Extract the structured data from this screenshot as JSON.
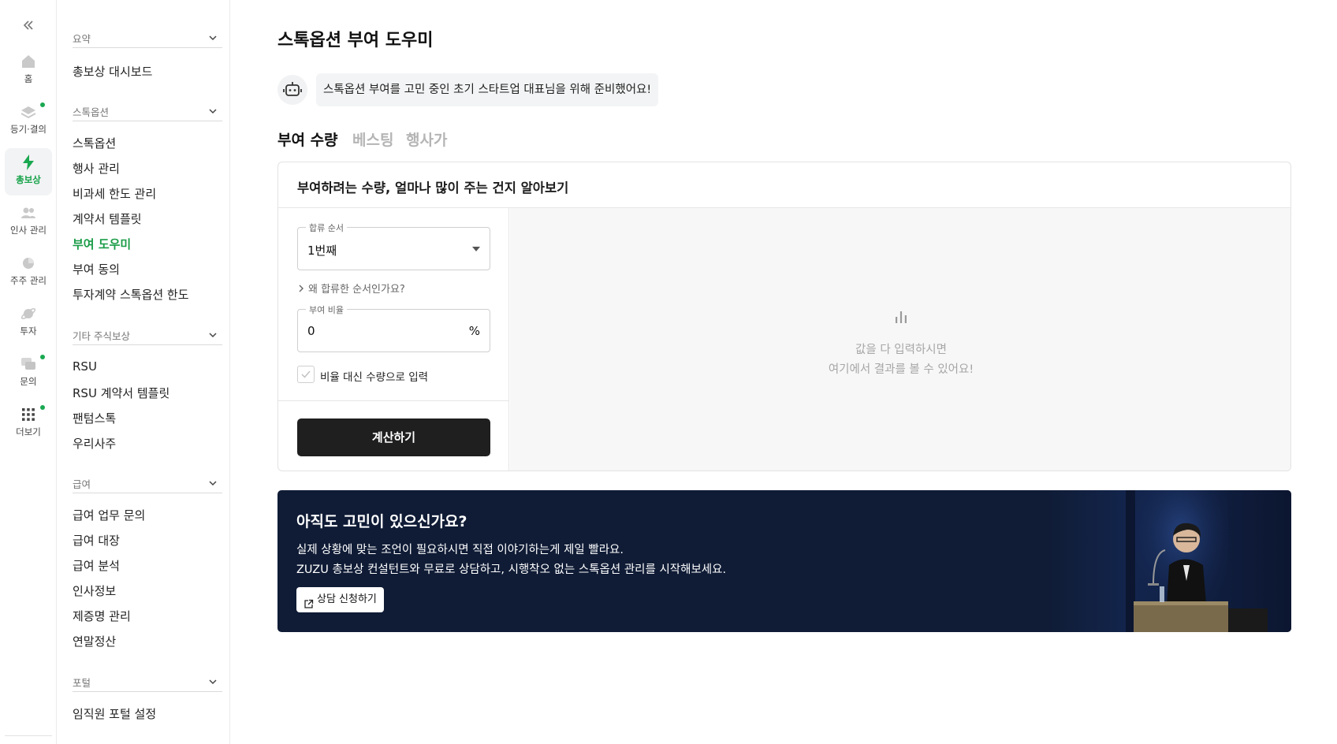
{
  "rail": {
    "items": [
      {
        "label": "홈",
        "icon": "home-icon"
      },
      {
        "label": "등기·결의",
        "icon": "layers-icon",
        "dot": true
      },
      {
        "label": "총보상",
        "icon": "bolt-icon",
        "active": true
      },
      {
        "label": "인사 관리",
        "icon": "people-icon"
      },
      {
        "label": "주주 관리",
        "icon": "pie-icon"
      },
      {
        "label": "투자",
        "icon": "planet-icon"
      },
      {
        "label": "문의",
        "icon": "chat-icon",
        "dot": true
      },
      {
        "label": "더보기",
        "icon": "grid-icon",
        "dot": true
      }
    ]
  },
  "subnav": {
    "sections": [
      {
        "title": "요약",
        "items": [
          "총보상 대시보드"
        ]
      },
      {
        "title": "스톡옵션",
        "items": [
          "스톡옵션",
          "행사 관리",
          "비과세 한도 관리",
          "계약서 템플릿",
          "부여 도우미",
          "부여 동의",
          "투자계약 스톡옵션 한도"
        ]
      },
      {
        "title": "기타 주식보상",
        "items": [
          "RSU",
          "RSU 계약서 템플릿",
          "팬텀스톡",
          "우리사주"
        ]
      },
      {
        "title": "급여",
        "items": [
          "급여 업무 문의",
          "급여 대장",
          "급여 분석",
          "인사정보",
          "제증명 관리",
          "연말정산"
        ]
      },
      {
        "title": "포털",
        "items": [
          "임직원 포털 설정"
        ]
      }
    ],
    "active_item": "부여 도우미"
  },
  "main": {
    "title": "스톡옵션 부여 도우미",
    "bot_message": "스톡옵션 부여를 고민 중인 초기 스타트업 대표님을 위해 준비했어요!",
    "tabs": [
      "부여 수량",
      "베스팅",
      "행사가"
    ],
    "active_tab": "부여 수량",
    "card": {
      "title": "부여하려는 수량, 얼마나 많이 주는 건지 알아보기",
      "join_order": {
        "legend": "합류 순서",
        "value": "1번째"
      },
      "why_link": "왜 합류한 순서인가요?",
      "grant_ratio": {
        "legend": "부여 비율",
        "value": "0",
        "suffix": "%"
      },
      "checkbox_label": "비율 대신 수량으로 입력",
      "calc_button": "계산하기",
      "empty_line1": "값을 다 입력하시면",
      "empty_line2": "여기에서 결과를 볼 수 있어요!"
    },
    "banner": {
      "title": "아직도 고민이 있으신가요?",
      "line1": "실제 상황에 맞는 조언이 필요하시면 직접 이야기하는게 제일 빨라요.",
      "line2": "ZUZU 총보상 컨설턴트와 무료로 상담하고, 시행착오 없는 스톡옵션 관리를 시작해보세요.",
      "button": "상담 신청하기"
    }
  },
  "colors": {
    "accent": "#1a9c47",
    "banner_bg": "#101c36",
    "button_dark": "#1f1f1f"
  }
}
